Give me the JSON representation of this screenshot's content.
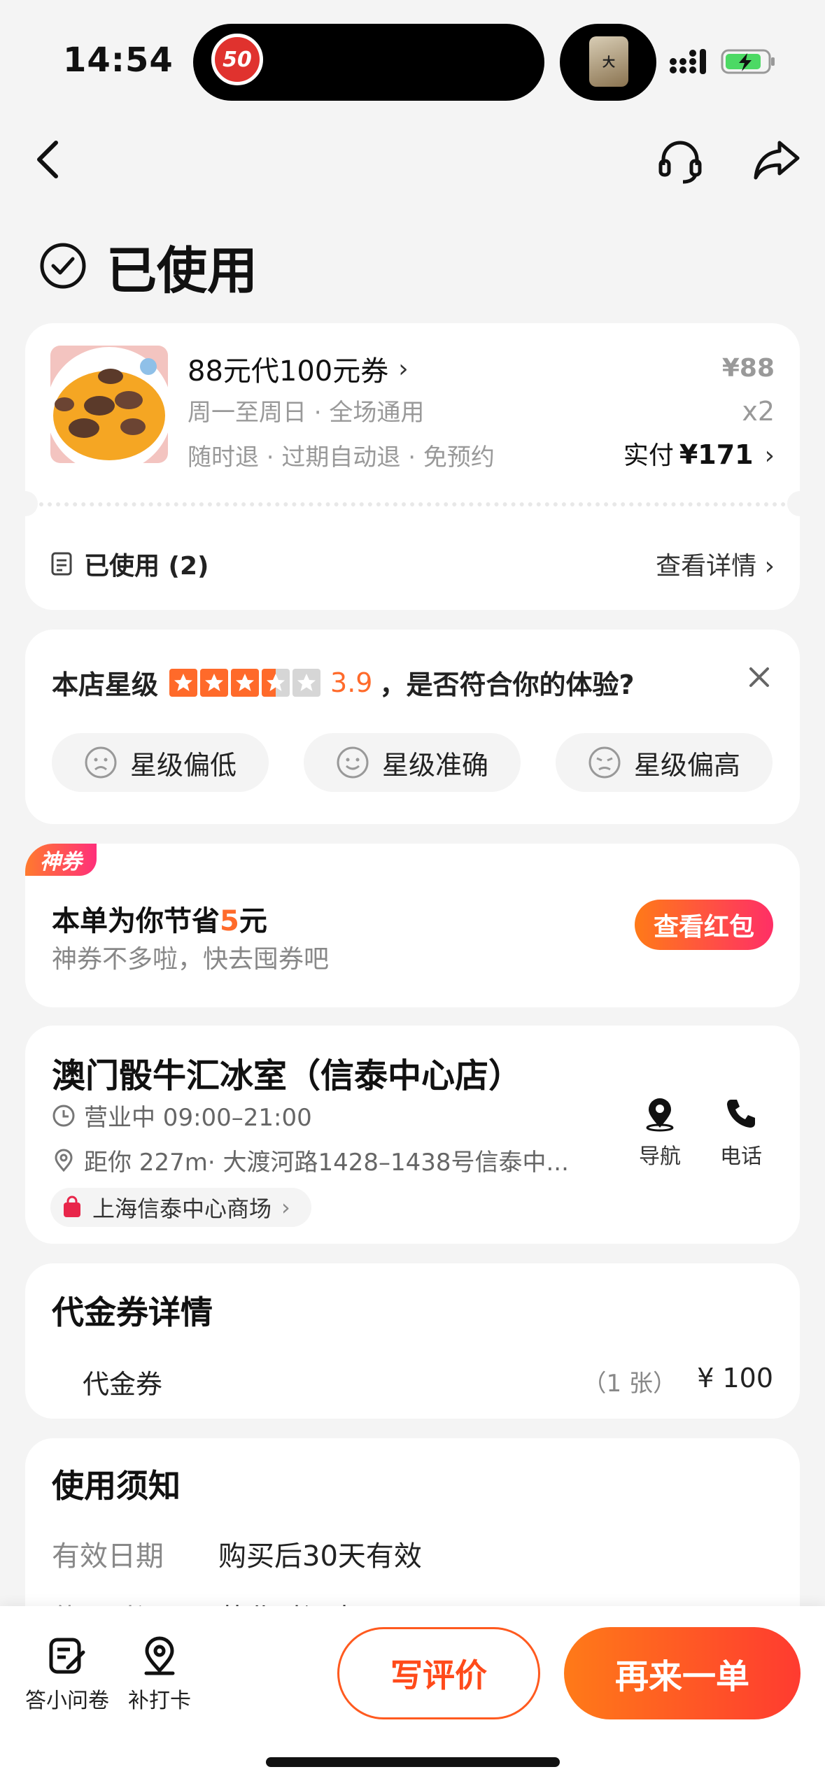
{
  "status_bar": {
    "time": "14:54",
    "speed_badge": "50",
    "app_thumb_label": "大",
    "battery_color": "#4cd964"
  },
  "nav": {
    "back_icon": "chevron-left-icon",
    "support_icon": "headset-icon",
    "share_icon": "share-icon"
  },
  "order_status": "已使用",
  "order": {
    "product_name": "88元代100元券",
    "chevron": "›",
    "sub1": "周一至周日 · 全场通用",
    "sub2": "随时退 · 过期自动退 · 免预约",
    "unit_price": "¥88",
    "quantity": "x2",
    "paid_label": "实付",
    "paid_amount": "¥171",
    "used_label": "已使用 (2)",
    "detail_link": "查看详情 ›"
  },
  "rating": {
    "prefix": "本店星级",
    "score": "3.9",
    "question": "，是否符合你的体验?",
    "stars": 3.5,
    "chips": [
      "星级偏低",
      "星级准确",
      "星级偏高"
    ]
  },
  "coupon": {
    "tag": "神券",
    "save_prefix": "本单为你节省",
    "save_amount": "5",
    "save_unit": "元",
    "sub": "神券不多啦，快去囤券吧",
    "button": "查看红包",
    "accent": "#ff6a2a"
  },
  "shop": {
    "name": "澳门骰牛汇冰室（信泰中心店）",
    "hours": "营业中 09:00–21:00",
    "distance": "距你 227m",
    "address": " · 大渡河路1428–1438号信泰中...",
    "mall": "上海信泰中心商场",
    "actions": [
      "导航",
      "电话"
    ]
  },
  "voucher_detail": {
    "title": "代金券详情",
    "item": "代金券",
    "count": "（1 张）",
    "price": "¥ 100"
  },
  "notice": {
    "title": "使用须知",
    "rows": [
      {
        "label": "有效日期",
        "value": "购买后30天有效"
      },
      {
        "label": "使用时间",
        "value": "营业时间内可用"
      }
    ]
  },
  "bottom_bar": {
    "survey": "答小问卷",
    "checkin": "补打卡",
    "review": "写评价",
    "reorder": "再来一单"
  }
}
